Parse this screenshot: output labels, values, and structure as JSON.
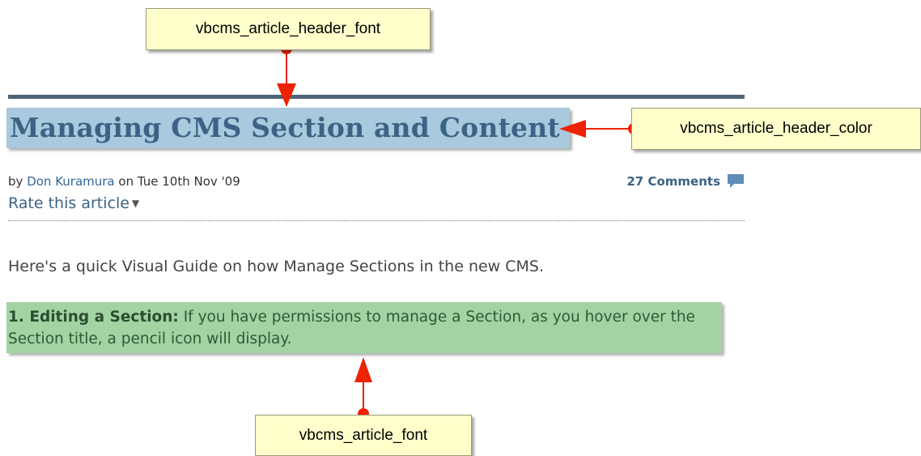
{
  "callouts": {
    "header_font": "vbcms_article_header_font",
    "header_color": "vbcms_article_header_color",
    "article_font": "vbcms_article_font"
  },
  "article": {
    "title": "Managing CMS Section and Content",
    "by_prefix": "by",
    "author": "Don Kuramura",
    "date_text": "on Tue 10th Nov '09",
    "comments": "27 Comments",
    "rate_label": "Rate this article",
    "intro": "Here's a quick Visual Guide on how Manage Sections in the new CMS.",
    "step_title": "1. Editing a Section:",
    "step_body": "If you have permissions to manage a Section, as you hover over the Section title, a pencil icon will display."
  },
  "colors": {
    "title_bg": "#a8c9de",
    "title_text": "#3c6385",
    "highlight_green": "#a3d3a3",
    "arrow_red": "#ee2200",
    "callout_bg": "#ffffcc"
  },
  "icons": {
    "comments": "comment-bubble-icon",
    "rate_dropdown": "triangle-down-icon"
  }
}
